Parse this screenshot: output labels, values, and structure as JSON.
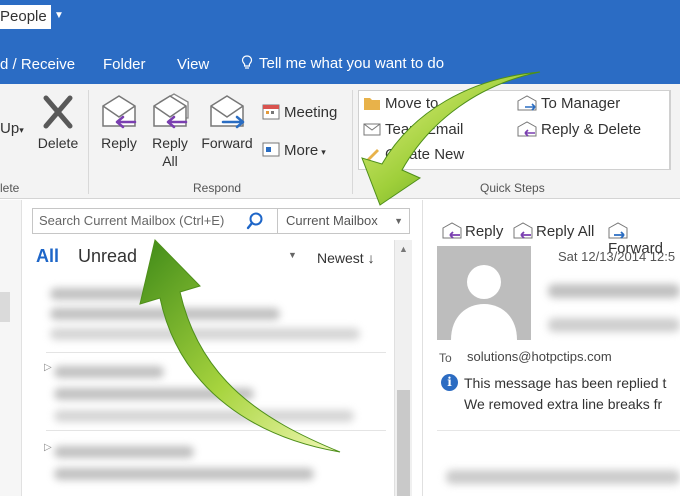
{
  "titlebar": {
    "title": "People"
  },
  "tabs": {
    "send_receive": "d / Receive",
    "folder": "Folder",
    "view": "View",
    "tell_me": "Tell me what you want to do"
  },
  "ribbon": {
    "up": "Up",
    "delete_label": "Delete",
    "delete_group": "lete",
    "reply": "Reply",
    "reply_all_line1": "Reply",
    "reply_all_line2": "All",
    "forward": "Forward",
    "meeting": "Meeting",
    "more": "More",
    "respond_group": "Respond",
    "quick_steps": {
      "move_to": "Move to",
      "team_email": "Team Email",
      "create_new": "Create New",
      "to_manager": "To Manager",
      "reply_delete": "Reply & Delete",
      "group_label": "Quick Steps"
    }
  },
  "search": {
    "placeholder": "Search Current Mailbox (Ctrl+E)",
    "scope": "Current Mailbox"
  },
  "list": {
    "filter_all": "All",
    "filter_unread": "Unread",
    "sort": "Newest"
  },
  "reading": {
    "reply": "Reply",
    "reply_all": "Reply All",
    "forward": "Forward",
    "date": "Sat 12/13/2014 12:5",
    "to_label": "To",
    "to_address": "solutions@hotpctips.com",
    "info_line1": "This message has been replied t",
    "info_line2": "We removed extra line breaks fr"
  },
  "colors": {
    "titlebar_blue": "#2b6cc4",
    "accent_blue": "#1e66c8",
    "arrow_green": "#5a9e22"
  }
}
